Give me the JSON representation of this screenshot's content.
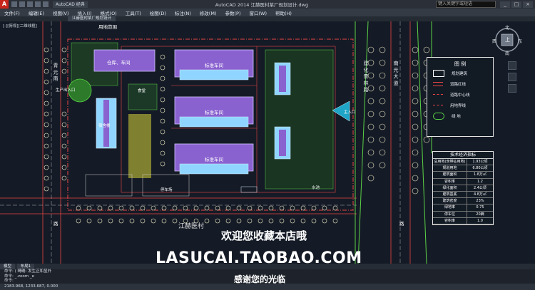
{
  "titlebar": {
    "app_logo": "A",
    "workspace": "AutoCAD 经典",
    "title": "AutoCAD 2014   江赫医村某厂规划设计.dwg",
    "search_placeholder": "键入关键字或短语",
    "min": "_",
    "max": "□",
    "close": "×"
  },
  "menu": [
    "文件(F)",
    "编辑(E)",
    "视图(V)",
    "插入(I)",
    "格式(O)",
    "工具(T)",
    "绘图(D)",
    "标注(N)",
    "修改(M)",
    "参数(P)",
    "窗口(W)",
    "帮助(H)"
  ],
  "tab": {
    "label": "江赫医村某厂规划设计"
  },
  "viewport": {
    "label": "[-][俯视][二维线框]"
  },
  "map_labels": {
    "land_boundary": "用地范围",
    "warehouse": "仓库、车间",
    "workshop1": "标准车间",
    "workshop2": "标准车间",
    "workshop3": "标准车间",
    "office": "办公楼",
    "canteen": "食堂",
    "dormitory": "宿舍楼",
    "court": "篮球场",
    "parking": "停车场",
    "main_entrance": "主入口",
    "side_entrance": "生产出入口",
    "pool": "水池",
    "road_left": "青 元 南",
    "road_right1": "建 化 景 林 路",
    "road_right2": "南 光 大 道",
    "road_bottom": "路",
    "north_road": "路"
  },
  "legend": {
    "title": "图  例",
    "items": [
      {
        "label": "规划建筑"
      },
      {
        "label": "道路红线"
      },
      {
        "label": "道路中心线"
      },
      {
        "label": "用地界线"
      },
      {
        "label": "绿  地"
      }
    ]
  },
  "econ": {
    "title": "技术经济指标",
    "rows": [
      {
        "k": "总用地(含带征用地)",
        "v": "1.93公顷"
      },
      {
        "k": "规划用地",
        "v": "6.80公顷"
      },
      {
        "k": "建筑面积",
        "v": "1.8万㎡"
      },
      {
        "k": "容积率",
        "v": "1.2"
      },
      {
        "k": "绿化面积",
        "v": "2.4公顷"
      },
      {
        "k": "建筑基底",
        "v": "4.8万㎡"
      },
      {
        "k": "建筑密度",
        "v": "23%"
      },
      {
        "k": "绿地率",
        "v": "0.75"
      },
      {
        "k": "停车位",
        "v": "20辆"
      },
      {
        "k": "容积率",
        "v": "1.0"
      }
    ]
  },
  "navcube": {
    "top": "北",
    "center": "上",
    "left": "西",
    "right": "东",
    "bottom": "南"
  },
  "watermark": {
    "line1": "欢迎您收藏本店哦",
    "line2": "LASUCAI.TAOBAO.COM",
    "line3": "感谢您的光临",
    "overlay": "江赫医村"
  },
  "layout_tabs": [
    "模型",
    "布局1"
  ],
  "command": {
    "line1": "命令: (  缚确: 发生正和显外",
    "line2": "命令: _.zoom _e",
    "prompt": "命令:"
  },
  "status": {
    "coords": "2183.968, 1233.687, 0.000"
  },
  "colors": {
    "building_fill": "#8a62d0",
    "building_stroke": "#cfc5ff",
    "road_red": "#e84545",
    "green": "#5ad147",
    "tree": "#f0efc8",
    "bg": "#151b26"
  }
}
